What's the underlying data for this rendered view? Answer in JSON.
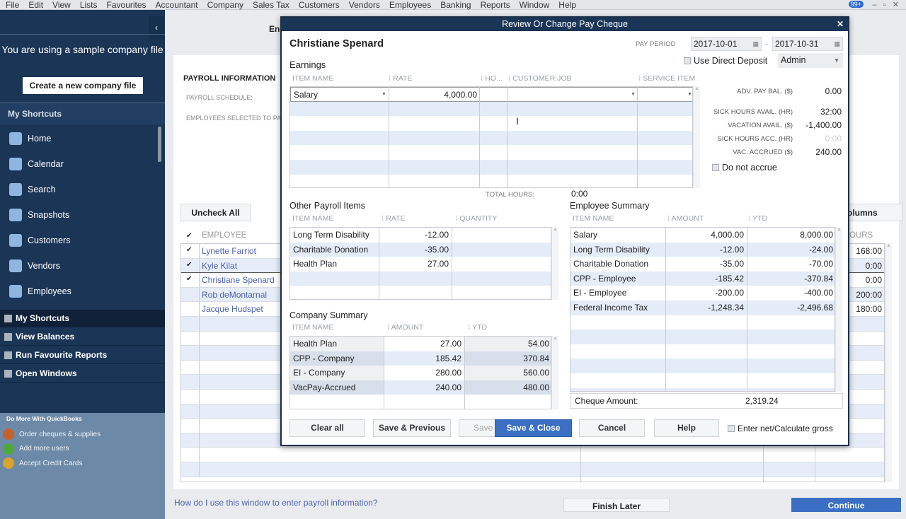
{
  "menu": [
    "File",
    "Edit",
    "View",
    "Lists",
    "Favourites",
    "Accountant",
    "Company",
    "Sales Tax",
    "Customers",
    "Vendors",
    "Employees",
    "Banking",
    "Reports",
    "Window",
    "Help"
  ],
  "notification_badge": "99+",
  "sidebar": {
    "sample_notice": "You are using a sample company file",
    "create_button": "Create a new company file",
    "shortcuts_header": "My Shortcuts",
    "items": [
      {
        "label": "Home",
        "icon": "home-icon"
      },
      {
        "label": "Calendar",
        "icon": "calendar-icon"
      },
      {
        "label": "Search",
        "icon": "search-icon"
      },
      {
        "label": "Snapshots",
        "icon": "snapshots-icon"
      },
      {
        "label": "Customers",
        "icon": "customers-icon"
      },
      {
        "label": "Vendors",
        "icon": "vendors-icon"
      },
      {
        "label": "Employees",
        "icon": "employees-icon"
      }
    ],
    "bottom": [
      "My Shortcuts",
      "View Balances",
      "Run Favourite Reports",
      "Open Windows"
    ],
    "do_more": {
      "header": "Do More With QuickBooks",
      "items": [
        {
          "label": "Order cheques & supplies",
          "color": "#c8602a"
        },
        {
          "label": "Add more users",
          "color": "#4fa83a"
        },
        {
          "label": "Accept Credit Cards",
          "color": "#d9a42a"
        }
      ]
    }
  },
  "main": {
    "header_partial": "En",
    "payroll_info": "PAYROLL INFORMATION",
    "payroll_schedule": "PAYROLL SCHEDULE:",
    "employees_selected": "EMPLOYEES SELECTED TO PA",
    "uncheck_all": "Uncheck All",
    "columns_button": "olumns",
    "col_employee": "EMPLOYEE",
    "col_hours": "OURS",
    "employees": [
      {
        "name": "Lynette Farriot",
        "checked": true,
        "hours": "168:00"
      },
      {
        "name": "Kyle Kilat",
        "checked": true,
        "hours": "0:00"
      },
      {
        "name": "Christiane Spenard",
        "checked": true,
        "hours": "0:00"
      },
      {
        "name": "Rob deMontarnal",
        "checked": false,
        "hours": "200:00"
      },
      {
        "name": "Jacque Hudspet",
        "checked": false,
        "hours": "180:00"
      }
    ],
    "help_link": "How do I use this window to enter payroll information?",
    "finish_later": "Finish Later",
    "continue": "Continue"
  },
  "dialog": {
    "title": "Review Or Change Pay Cheque",
    "employee": "Christiane Spenard",
    "pay_period_label": "PAY PERIOD",
    "pay_from": "2017-10-01",
    "pay_to": "2017-10-31",
    "direct_deposit": "Use Direct Deposit",
    "class": "Admin",
    "earnings": {
      "title": "Earnings",
      "cols": [
        "ITEM NAME",
        "RATE",
        "HO...",
        "CUSTOMER:JOB",
        "SERVICE ITEM"
      ],
      "rows": [
        [
          "Salary",
          "4,000.00",
          "",
          "",
          ""
        ]
      ],
      "total_hours_label": "TOTAL HOURS:",
      "total_hours": "0:00"
    },
    "balances": [
      {
        "label": "ADV. PAY BAL. ($)",
        "value": "0.00"
      },
      {
        "label": "SICK HOURS AVAIL. (HR)",
        "value": "32:00"
      },
      {
        "label": "VACATION AVAIL. ($)",
        "value": "-1,400.00"
      },
      {
        "label": "SICK HOURS ACC. (HR)",
        "value": "0:00"
      },
      {
        "label": "VAC. ACCRUED ($)",
        "value": "240.00"
      }
    ],
    "do_not_accrue": "Do not accrue",
    "other": {
      "title": "Other Payroll Items",
      "cols": [
        "ITEM NAME",
        "RATE",
        "QUANTITY"
      ],
      "rows": [
        [
          "Long Term Disability",
          "-12.00",
          ""
        ],
        [
          "Charitable Donation",
          "-35.00",
          ""
        ],
        [
          "Health Plan",
          "27.00",
          ""
        ]
      ]
    },
    "company": {
      "title": "Company Summary",
      "cols": [
        "ITEM NAME",
        "AMOUNT",
        "YTD"
      ],
      "rows": [
        [
          "Health Plan",
          "27.00",
          "54.00"
        ],
        [
          "CPP - Company",
          "185.42",
          "370.84"
        ],
        [
          "EI - Company",
          "280.00",
          "560.00"
        ],
        [
          "VacPay-Accrued",
          "240.00",
          "480.00"
        ]
      ]
    },
    "employee_summary": {
      "title": "Employee Summary",
      "cols": [
        "ITEM NAME",
        "AMOUNT",
        "YTD"
      ],
      "rows": [
        [
          "Salary",
          "4,000.00",
          "8,000.00"
        ],
        [
          "Long Term Disability",
          "-12.00",
          "-24.00"
        ],
        [
          "Charitable Donation",
          "-35.00",
          "-70.00"
        ],
        [
          "CPP - Employee",
          "-185.42",
          "-370.84"
        ],
        [
          "EI - Employee",
          "-200.00",
          "-400.00"
        ],
        [
          "Federal Income Tax",
          "-1,248.34",
          "-2,496.68"
        ]
      ],
      "cheque_label": "Cheque Amount:",
      "cheque_amount": "2,319.24"
    },
    "buttons": {
      "clear": "Clear all",
      "save_prev": "Save & Previous",
      "save": "Save",
      "save_close": "Save & Close",
      "cancel": "Cancel",
      "help": "Help"
    },
    "net_gross": "Enter net/Calculate gross"
  },
  "colors": {
    "navy": "#1b3556",
    "accent_blue": "#3a6fc4"
  }
}
